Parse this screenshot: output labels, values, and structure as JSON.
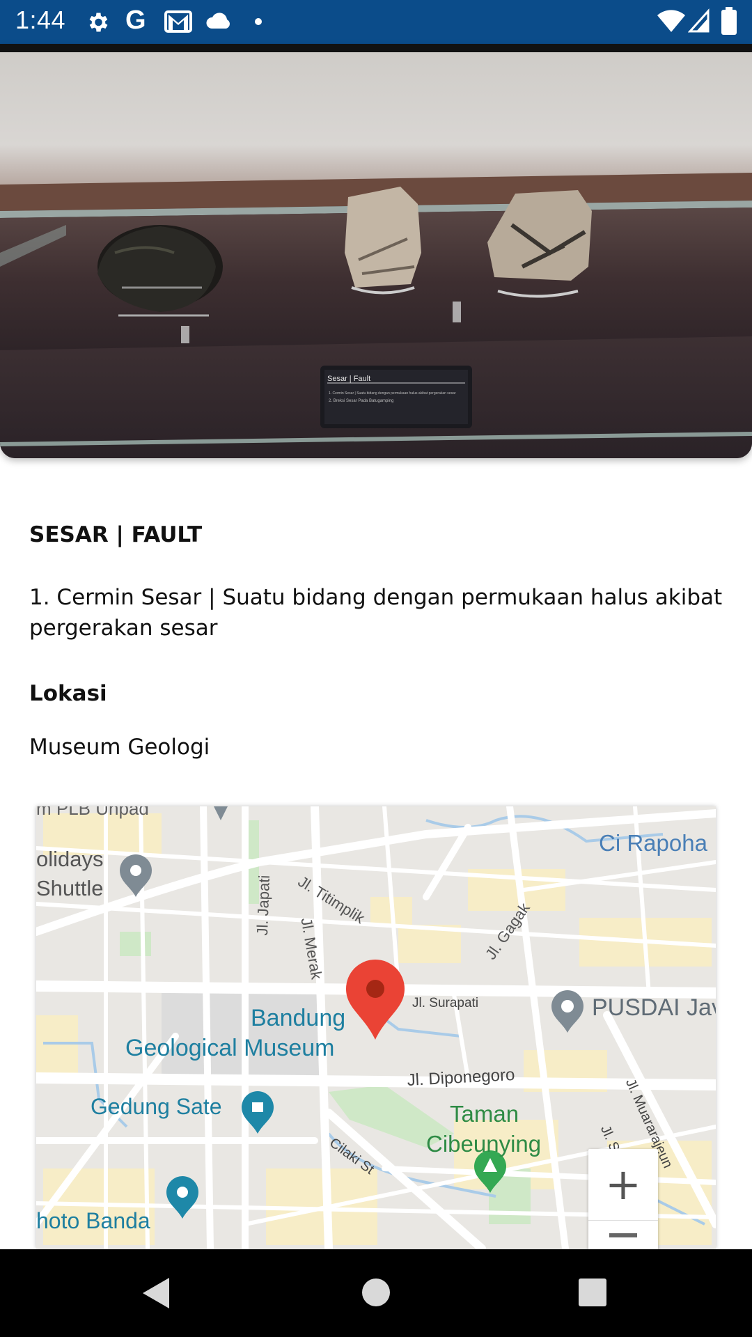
{
  "status_bar": {
    "time": "1:44",
    "icons": [
      "settings-icon",
      "google-icon",
      "gmail-icon",
      "cloud-icon",
      "dot-icon",
      "wifi-icon",
      "signal-icon",
      "battery-icon"
    ],
    "background": "#0b4c8a"
  },
  "photo": {
    "label_title": "Sesar | Fault",
    "label_line1": "1. Cermin Sesar | Suatu bidang dengan permukaan halus akibat pergerakan sesar",
    "label_line2": "2. Breksi Sesar Pada Batugamping"
  },
  "detail": {
    "title": "SESAR | FAULT",
    "description": "1. Cermin Sesar | Suatu bidang dengan permukaan halus akibat pergerakan sesar",
    "location_heading": "Lokasi",
    "location_value": "Museum Geologi"
  },
  "map": {
    "labels": {
      "holidays_1": "olidays",
      "holidays_2": "Shuttle",
      "ci_rapoha": "Ci Rapoha",
      "jl_titimplik": "Jl. Titimplik",
      "jl_japati": "Jl. Japati",
      "jl_merak": "Jl. Merak",
      "jl_gagak": "Jl. Gagak",
      "jl_surapati": "Jl. Surapati",
      "pusdai": "PUSDAI Jav",
      "bandung": "Bandung",
      "geological_museum": "Geological Museum",
      "jl_diponegoro": "Jl. Diponegoro",
      "gedung_sate": "Gedung Sate",
      "taman_1": "Taman",
      "taman_2": "Cibeunying",
      "cilaki": "Cilaki St",
      "jl_muararajeun": "Jl. Muararajeun",
      "jl_supratman": "Jl. Supratman",
      "foto_banda": "hoto Banda",
      "top_cut": "m PLB Unpad"
    },
    "zoom_in": "+",
    "colors": {
      "pin": "#ea4335",
      "park": "#34a853",
      "poi_blue": "#1e88a8"
    }
  },
  "nav_bar": {
    "back": "back-icon",
    "home": "home-icon",
    "recents": "recents-icon"
  }
}
